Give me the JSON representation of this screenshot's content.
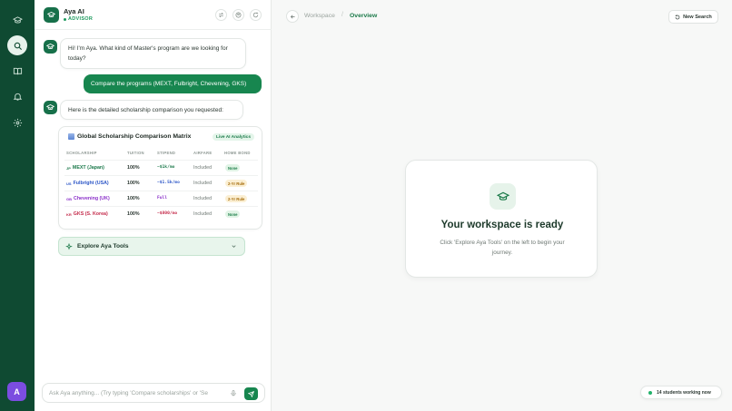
{
  "rail": {
    "items": [
      {
        "name": "graduation-cap-icon",
        "active": false
      },
      {
        "name": "search-icon",
        "active": true
      },
      {
        "name": "book-icon",
        "active": false
      },
      {
        "name": "bell-icon",
        "active": false
      },
      {
        "name": "settings-icon",
        "active": false
      }
    ],
    "avatar_initial": "A",
    "avatar_color": "#7b4de0"
  },
  "chat": {
    "header": {
      "name": "Aya AI",
      "role": "ADVISOR",
      "actions": [
        "swap-icon",
        "user-circle-icon",
        "refresh-icon"
      ]
    },
    "messages": {
      "greeting": "Hi! I'm Aya. What kind of Master's program are we looking for today?",
      "user_request": "Compare the programs (MEXT, Fulbright, Chevening, GKS)",
      "reply": "Here is the detailed scholarship comparison you requested:"
    },
    "matrix": {
      "title": "Global Scholarship Comparison Matrix",
      "badge": "Live AI Analytics",
      "columns": [
        "SCHOLARSHIP",
        "TUITION",
        "STIPEND",
        "AIRFARE",
        "HOME BOND"
      ],
      "rows": [
        {
          "flag": "JP",
          "name": "MEXT (Japan)",
          "tuition": "100%",
          "stipend": "~$1k/mo",
          "airfare": "Included",
          "bond": "None",
          "bond_tone": "green",
          "color": "#1d7a4c"
        },
        {
          "flag": "US",
          "name": "Fulbright (USA)",
          "tuition": "100%",
          "stipend": "~$1.5k/mo",
          "airfare": "Included",
          "bond": "2-Yr Rule",
          "bond_tone": "amber",
          "color": "#2c56c7"
        },
        {
          "flag": "GB",
          "name": "Chevening (UK)",
          "tuition": "100%",
          "stipend": "Full",
          "airfare": "Included",
          "bond": "2-Yr Rule",
          "bond_tone": "amber",
          "color": "#8a2fc9"
        },
        {
          "flag": "KR",
          "name": "GKS (S. Korea)",
          "tuition": "100%",
          "stipend": "~$800/mo",
          "airfare": "Included",
          "bond": "None",
          "bond_tone": "green",
          "color": "#c42a4a"
        }
      ]
    },
    "explore_label": "Explore Aya Tools",
    "composer_placeholder": "Ask Aya anything... (Try typing 'Compare scholarships' or 'Se"
  },
  "workspace": {
    "breadcrumb": {
      "parent": "Workspace",
      "separator": "/",
      "current": "Overview"
    },
    "new_search_label": "New Search",
    "card": {
      "title": "Your workspace is ready",
      "subtitle": "Click 'Explore Aya Tools' on the left to begin your journey."
    },
    "status": "14 students working now"
  },
  "colors": {
    "brand": "#17864f",
    "rail": "#0f4a32"
  }
}
